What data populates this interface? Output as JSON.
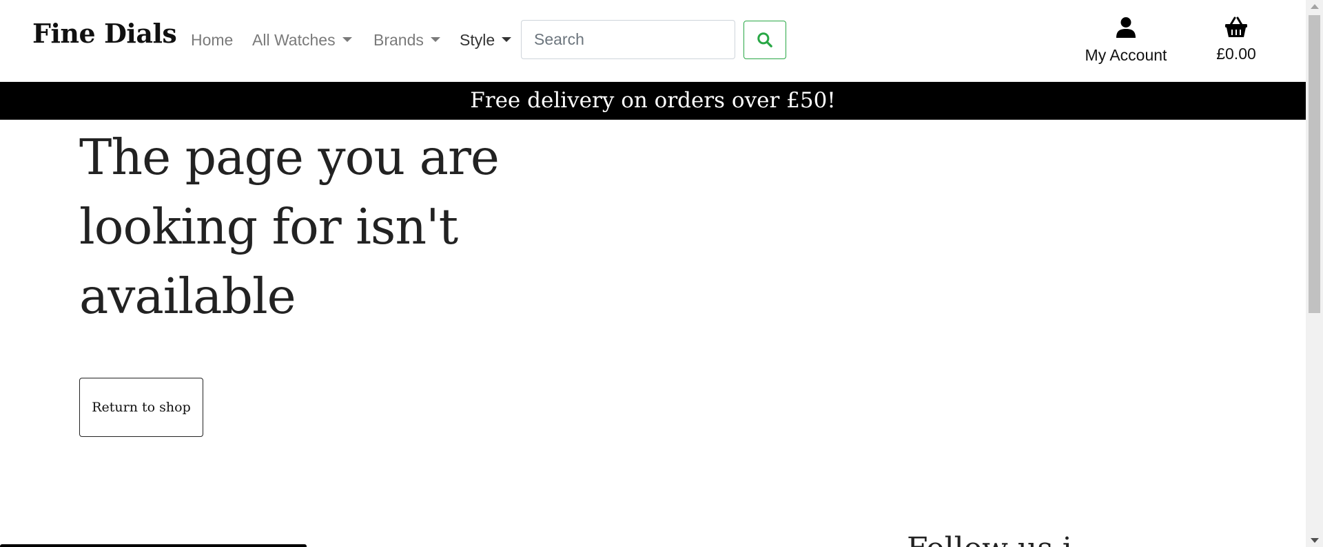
{
  "header": {
    "logo": "Fine Dials",
    "nav": {
      "home": "Home",
      "all_watches": "All Watches",
      "brands": "Brands",
      "style": "Style"
    },
    "search": {
      "placeholder": "Search",
      "value": ""
    },
    "account_label": "My Account",
    "basket_total": "£0.00"
  },
  "banner": {
    "text": "Free delivery on orders over £50!"
  },
  "main": {
    "heading": "The page you are looking for isn't available",
    "return_button": "Return to shop"
  },
  "footer": {
    "heading": "Follow us i"
  },
  "colors": {
    "accent_green": "#28a745",
    "banner_bg": "#000000",
    "text_dark": "#222222",
    "nav_muted": "#7a7a7a"
  },
  "icons": {
    "search": "search-icon",
    "account": "user-icon",
    "basket": "basket-icon"
  }
}
